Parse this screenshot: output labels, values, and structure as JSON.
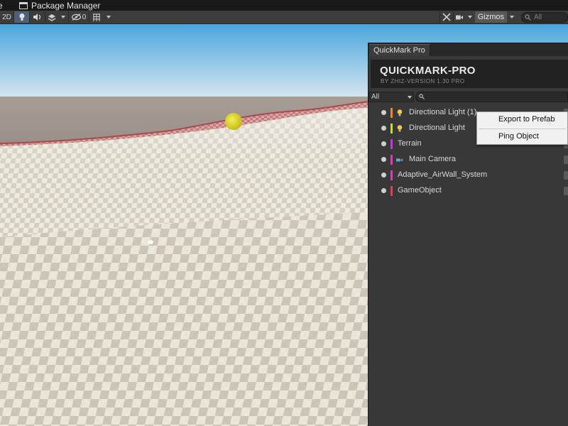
{
  "menu": {
    "cut_item": "e",
    "package_manager": "Package Manager"
  },
  "toolbar": {
    "mode_2d": "2D",
    "hidden_count": "0",
    "gizmos_label": "Gizmos",
    "search_placeholder": "All"
  },
  "panel": {
    "tab_label": "QuickMark Pro",
    "title": "QUICKMARK-PRO",
    "subtitle": "BY ZHIZ-VERSION 1.30 PRO",
    "filter_value": "All",
    "items": [
      {
        "label": "Directional Light (1)",
        "bar_color": "#e8863a",
        "icon": "light-bulb-icon"
      },
      {
        "label": "Directional Light",
        "bar_color": "#c8e026",
        "icon": "light-bulb-icon"
      },
      {
        "label": "Terrain",
        "bar_color": "#c03ad8",
        "icon": ""
      },
      {
        "label": "Main Camera",
        "bar_color": "#e03ab8",
        "icon": "camera-icon"
      },
      {
        "label": "Adaptive_AirWall_System",
        "bar_color": "#e03ab8",
        "icon": ""
      },
      {
        "label": "GameObject",
        "bar_color": "#e83a5a",
        "icon": ""
      }
    ]
  },
  "context_menu": {
    "export": "Export to Prefab",
    "ping": "Ping Object"
  }
}
